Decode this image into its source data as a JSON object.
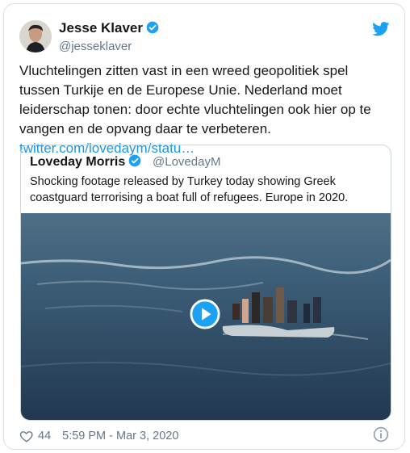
{
  "tweet": {
    "author_name": "Jesse Klaver",
    "author_handle": "@jesseklaver",
    "text": "Vluchtelingen zitten vast in een wreed geopolitiek spel tussen Turkije en de Europese Unie. Nederland moet leiderschap tonen: door echte vluchtelingen ook hier op te vangen en de opvang daar te verbeteren. ",
    "link": "twitter.com/lovedaym/statu…"
  },
  "quoted_tweet": {
    "author_name": "Loveday Morris",
    "author_handle": "@LovedayM",
    "text": "Shocking footage released by Turkey today showing Greek coastguard terrorising a boat full of refugees. Europe in 2020."
  },
  "footer": {
    "likes": "44",
    "timestamp": "5:59 PM - Mar 3, 2020"
  },
  "icons": {
    "brand": "twitter-bird-icon",
    "verified": "verified-badge-icon",
    "like": "heart-icon",
    "info": "info-icon",
    "play": "play-icon"
  },
  "colors": {
    "accent": "#1da1f2",
    "link": "#1b95e0",
    "text": "#14171a",
    "muted": "#657786"
  }
}
